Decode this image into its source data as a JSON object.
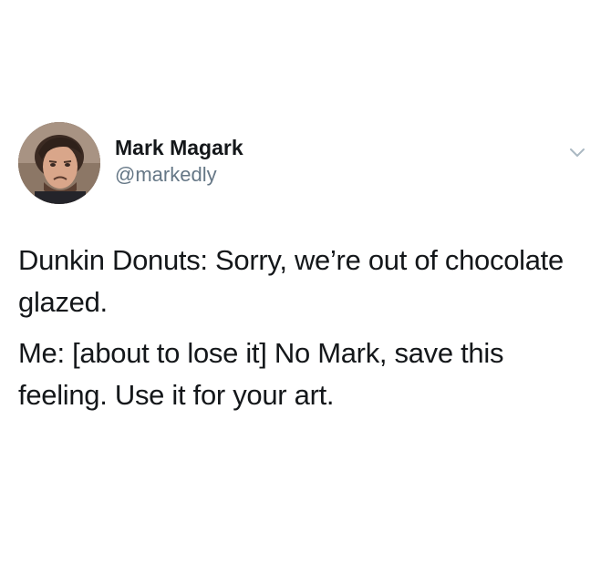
{
  "tweet": {
    "author": {
      "display_name": "Mark Magark",
      "handle": "@markedly",
      "avatar_icon": "profile-photo"
    },
    "menu_icon": "chevron-down-icon",
    "paragraphs": [
      "Dunkin Donuts: Sorry, we’re out of chocolate glazed.",
      "Me: [about to lose it] No Mark, save this feeling. Use it for your art."
    ]
  },
  "colors": {
    "background": "#ffffff",
    "text": "#14171a",
    "secondary_text": "#657786",
    "chevron": "#aab8c2"
  }
}
